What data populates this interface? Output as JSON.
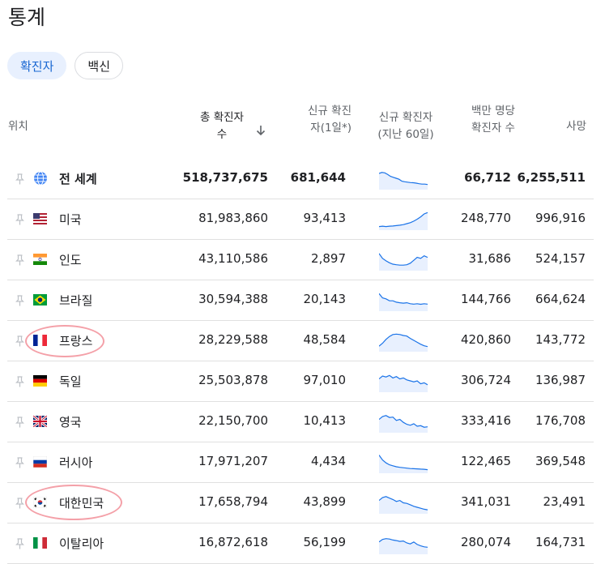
{
  "page": {
    "title": "통계"
  },
  "tabs": [
    {
      "label": "확진자",
      "active": true
    },
    {
      "label": "백신",
      "active": false
    }
  ],
  "table": {
    "headers": {
      "location": "위치",
      "total_cases": "총 확진자 수",
      "new_cases": "신규 확진자(1일*)",
      "trend": "신규 확진자 (지난 60일)",
      "per_million": "백만 명당 확진자 수",
      "deaths": "사망"
    },
    "sort_icon": "arrow-down-icon",
    "rows": [
      {
        "name": "전 세계",
        "icon": "globe-icon",
        "total": "518,737,675",
        "new": "681,644",
        "per_million": "66,712",
        "deaths": "6,255,511",
        "trend": [
          0.75,
          0.8,
          0.78,
          0.7,
          0.6,
          0.55,
          0.5,
          0.45,
          0.35,
          0.32,
          0.3,
          0.28,
          0.27,
          0.25,
          0.22,
          0.2,
          0.2,
          0.18
        ]
      },
      {
        "name": "미국",
        "icon": "flag-us-icon",
        "total": "81,983,860",
        "new": "93,413",
        "per_million": "248,770",
        "deaths": "996,916",
        "trend": [
          0.1,
          0.12,
          0.1,
          0.12,
          0.13,
          0.15,
          0.17,
          0.2,
          0.25,
          0.3,
          0.38,
          0.48,
          0.6,
          0.75,
          0.82
        ]
      },
      {
        "name": "인도",
        "icon": "flag-in-icon",
        "total": "43,110,586",
        "new": "2,897",
        "per_million": "31,686",
        "deaths": "524,157",
        "trend": [
          0.8,
          0.55,
          0.42,
          0.32,
          0.25,
          0.22,
          0.2,
          0.2,
          0.22,
          0.3,
          0.45,
          0.6,
          0.55,
          0.68,
          0.6
        ]
      },
      {
        "name": "브라질",
        "icon": "flag-br-icon",
        "total": "30,594,388",
        "new": "20,143",
        "per_million": "144,766",
        "deaths": "664,624",
        "trend": [
          0.82,
          0.6,
          0.55,
          0.45,
          0.45,
          0.38,
          0.35,
          0.33,
          0.35,
          0.3,
          0.28,
          0.3,
          0.27,
          0.3,
          0.28
        ]
      },
      {
        "name": "프랑스",
        "icon": "flag-fr-icon",
        "total": "28,229,588",
        "new": "48,584",
        "per_million": "420,860",
        "deaths": "143,772",
        "trend": [
          0.2,
          0.35,
          0.55,
          0.7,
          0.8,
          0.82,
          0.8,
          0.75,
          0.72,
          0.6,
          0.5,
          0.4,
          0.3,
          0.22,
          0.18
        ]
      },
      {
        "name": "독일",
        "icon": "flag-de-icon",
        "total": "25,503,878",
        "new": "97,010",
        "per_million": "306,724",
        "deaths": "136,987",
        "trend": [
          0.6,
          0.75,
          0.7,
          0.78,
          0.65,
          0.72,
          0.6,
          0.65,
          0.55,
          0.5,
          0.45,
          0.5,
          0.35,
          0.4,
          0.3
        ]
      },
      {
        "name": "영국",
        "icon": "flag-gb-icon",
        "total": "22,150,700",
        "new": "10,413",
        "per_million": "333,416",
        "deaths": "176,708",
        "trend": [
          0.6,
          0.75,
          0.8,
          0.7,
          0.72,
          0.55,
          0.6,
          0.45,
          0.35,
          0.3,
          0.38,
          0.25,
          0.28,
          0.2,
          0.22
        ]
      },
      {
        "name": "러시아",
        "icon": "flag-ru-icon",
        "total": "17,971,207",
        "new": "4,434",
        "per_million": "122,465",
        "deaths": "369,548",
        "trend": [
          0.85,
          0.6,
          0.45,
          0.35,
          0.3,
          0.25,
          0.22,
          0.2,
          0.18,
          0.16,
          0.15,
          0.14,
          0.13,
          0.12,
          0.1
        ]
      },
      {
        "name": "대한민국",
        "icon": "flag-kr-icon",
        "total": "17,658,794",
        "new": "43,899",
        "per_million": "341,031",
        "deaths": "23,491",
        "trend": [
          0.6,
          0.75,
          0.8,
          0.72,
          0.65,
          0.55,
          0.6,
          0.48,
          0.45,
          0.38,
          0.3,
          0.25,
          0.2,
          0.15,
          0.12
        ]
      },
      {
        "name": "이탈리아",
        "icon": "flag-it-icon",
        "total": "16,872,618",
        "new": "56,199",
        "per_million": "280,074",
        "deaths": "164,731",
        "trend": [
          0.55,
          0.68,
          0.72,
          0.7,
          0.65,
          0.62,
          0.58,
          0.6,
          0.5,
          0.45,
          0.55,
          0.42,
          0.35,
          0.3,
          0.28
        ]
      }
    ]
  },
  "colors": {
    "accent": "#1967d2",
    "tab_active_bg": "#e8f0fe",
    "spark_line": "#1a73e8",
    "spark_fill": "#e8f0fe",
    "annotation": "#f4a0a8"
  }
}
